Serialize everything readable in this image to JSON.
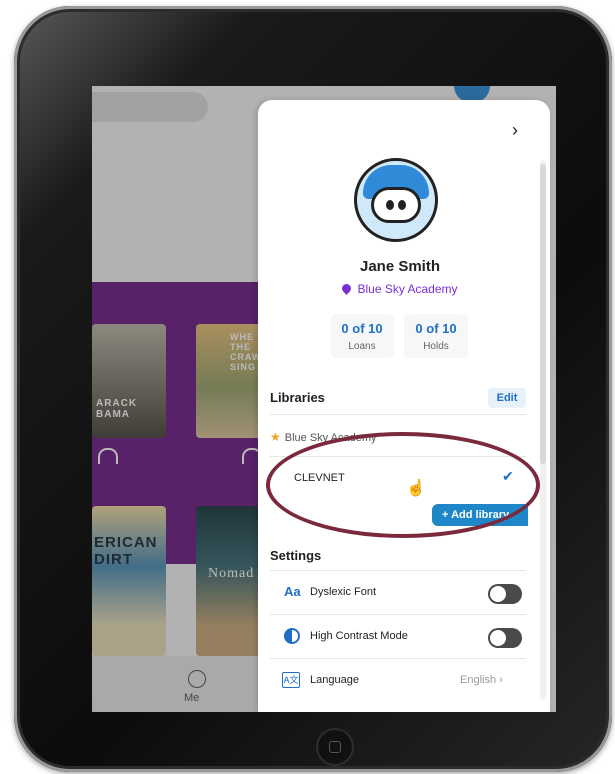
{
  "background_app": {
    "bottom_nav": {
      "me_label": "Me"
    },
    "covers": [
      {
        "text": "ARACK\nBAMA"
      },
      {
        "text": "WHE\nTHE\nCRAWD\nSING"
      },
      {
        "text": "ERICAN\nDIRT"
      },
      {
        "text": "Nomad"
      }
    ]
  },
  "panel": {
    "close_chevron": "›",
    "user": {
      "name": "Jane Smith",
      "school": "Blue Sky Academy"
    },
    "stats": [
      {
        "value": "0 of 10",
        "label": "Loans"
      },
      {
        "value": "0 of 10",
        "label": "Holds"
      }
    ],
    "libraries": {
      "title": "Libraries",
      "edit_label": "Edit",
      "items": [
        {
          "name": "Blue Sky Academy",
          "starred": true
        },
        {
          "name": "CLEVNET",
          "selected": true
        }
      ],
      "add_label": "+ Add library"
    },
    "settings": {
      "title": "Settings",
      "items": [
        {
          "icon_text": "Aa",
          "label": "Dyslexic Font",
          "toggle": false
        },
        {
          "label": "High Contrast Mode",
          "toggle": false
        },
        {
          "icon_text": "A文",
          "label": "Language",
          "value": "English"
        }
      ]
    }
  },
  "colors": {
    "accent": "#1f6fc4",
    "school": "#7a2fd6",
    "highlight_ellipse": "#7b2a3e",
    "bezel": "#0c0c0c"
  }
}
